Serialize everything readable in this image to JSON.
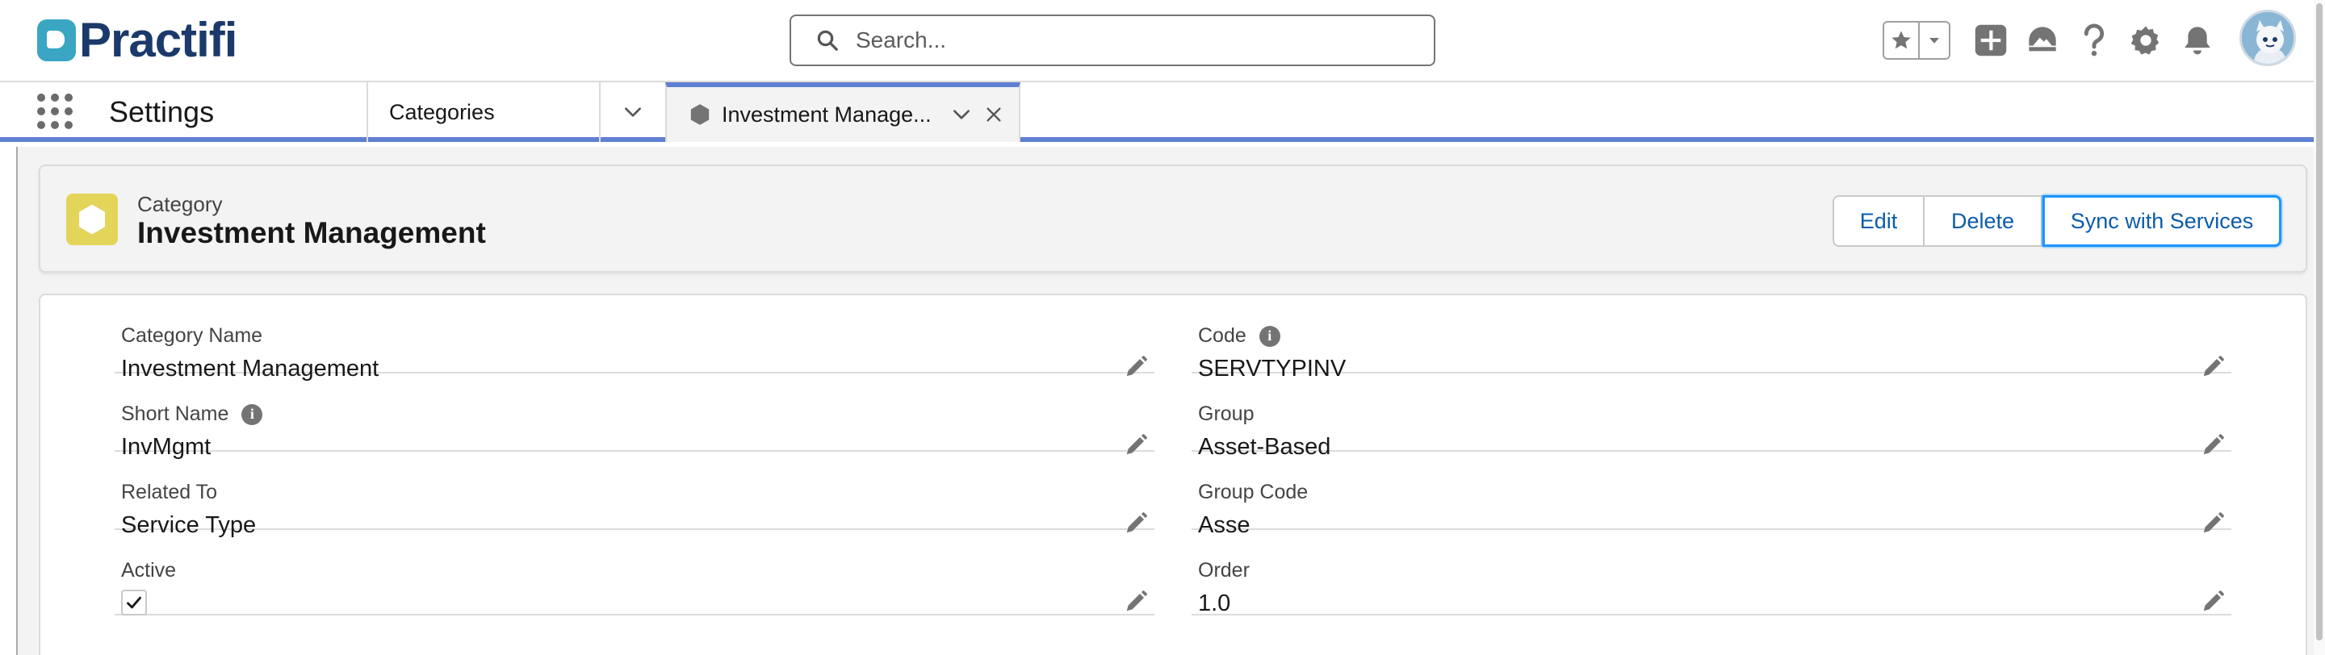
{
  "brand": {
    "name": "Practifi"
  },
  "search": {
    "placeholder": "Search..."
  },
  "header_icons": [
    "favorites-star-icon",
    "favorites-caret-icon",
    "global-create-icon",
    "trailhead-icon",
    "help-icon",
    "setup-gear-icon",
    "notifications-bell-icon",
    "avatar"
  ],
  "nav": {
    "app_name": "Settings",
    "categories_label": "Categories",
    "tab_label": "Investment Manage..."
  },
  "record": {
    "type": "Category",
    "title": "Investment Management",
    "icon_color": "#e3d45a",
    "actions": {
      "edit": "Edit",
      "delete": "Delete",
      "sync": "Sync with Services"
    }
  },
  "fields": {
    "category_name": {
      "label": "Category Name",
      "value": "Investment Management"
    },
    "short_name": {
      "label": "Short Name",
      "value": "InvMgmt"
    },
    "related_to": {
      "label": "Related To",
      "value": "Service Type"
    },
    "active": {
      "label": "Active",
      "checked": true
    },
    "code": {
      "label": "Code",
      "value": "SERVTYPINV"
    },
    "group": {
      "label": "Group",
      "value": "Asset-Based"
    },
    "group_code": {
      "label": "Group Code",
      "value": "Asse"
    },
    "order": {
      "label": "Order",
      "value": "1.0"
    }
  },
  "colors": {
    "accent": "#5f7fd1",
    "link": "#0b5cab",
    "brand_text": "#1b3a6b",
    "brand_mark": "#3aa6c4"
  }
}
